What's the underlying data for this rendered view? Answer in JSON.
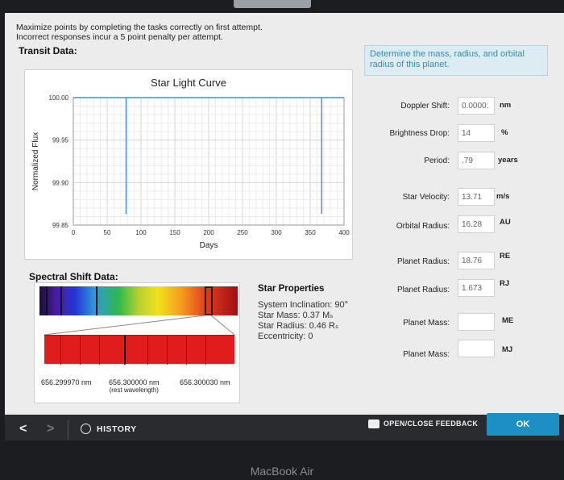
{
  "instructions": {
    "line1": "Maximize points by completing the tasks correctly on first attempt.",
    "line2": "Incorrect responses incur a 5 point penalty per attempt."
  },
  "transit": {
    "title": "Transit Data:",
    "chart": {
      "title": "Star Light Curve",
      "ylabel": "Normalized Flux",
      "xlabel": "Days"
    }
  },
  "chart_data": {
    "type": "line",
    "title": "Star Light Curve",
    "xlabel": "Days",
    "ylabel": "Normalized Flux",
    "xlim": [
      0,
      400
    ],
    "ylim": [
      99.85,
      100.0
    ],
    "x_ticks": [
      "0",
      "50",
      "100",
      "150",
      "200",
      "250",
      "300",
      "350",
      "400"
    ],
    "y_ticks": [
      "100.00",
      "99.95",
      "99.90",
      "99.85"
    ],
    "grid": true,
    "series": [
      {
        "x": [
          0,
          78,
          78,
          78,
          78,
          367,
          367,
          367,
          367,
          400
        ],
        "y": [
          100.0,
          100.0,
          99.863,
          99.863,
          100.0,
          100.0,
          99.863,
          99.863,
          100.0,
          100.0
        ]
      }
    ]
  },
  "question": {
    "text": "Determine the mass, radius, and orbital radius of this planet."
  },
  "properties": {
    "doppler": {
      "label": "Doppler Shift:",
      "value": "0.0000:",
      "unit": "nm"
    },
    "brightness": {
      "label": "Brightness Drop:",
      "value": "14",
      "unit": "%"
    },
    "period": {
      "label": "Period:",
      "value": ".79",
      "unit": "years"
    },
    "velocity": {
      "label": "Star Velocity:",
      "value": "13.71",
      "unit": "m/s"
    },
    "orbital": {
      "label": "Orbital Radius:",
      "value": "16.28",
      "unit": "AU"
    },
    "radius_e": {
      "label": "Planet Radius:",
      "value": "18.76",
      "unit": "RE"
    },
    "radius_j": {
      "label": "Planet Radius:",
      "value": "1.673",
      "unit": "RJ"
    },
    "mass_e": {
      "label": "Planet Mass:",
      "value": "",
      "unit": "ME"
    },
    "mass_j": {
      "label": "Planet Mass:",
      "value": "",
      "unit": "MJ"
    }
  },
  "spectral": {
    "title": "Spectral Shift Data:",
    "wl_left": "656.299970 nm",
    "wl_mid": "656.300000 nm",
    "wl_mid_sub": "(rest wavelength)",
    "wl_right": "656.300030 nm"
  },
  "star_properties": {
    "heading": "Star Properties",
    "inclination": "System Inclination: 90°",
    "mass": "Star Mass: 0.37 Mₛ",
    "radius": "Star Radius: 0.46 Rₛ",
    "eccentricity": "Eccentricity: 0"
  },
  "footer": {
    "history": "HISTORY",
    "feedback": "OPEN/CLOSE FEEDBACK",
    "ok": "OK"
  },
  "brand": "MacBook Air",
  "colors": {
    "accent": "#1d8fc4",
    "question_bg": "#dcecf2",
    "question_text": "#3c8aa6",
    "transit_line": "#4a8fd6"
  }
}
